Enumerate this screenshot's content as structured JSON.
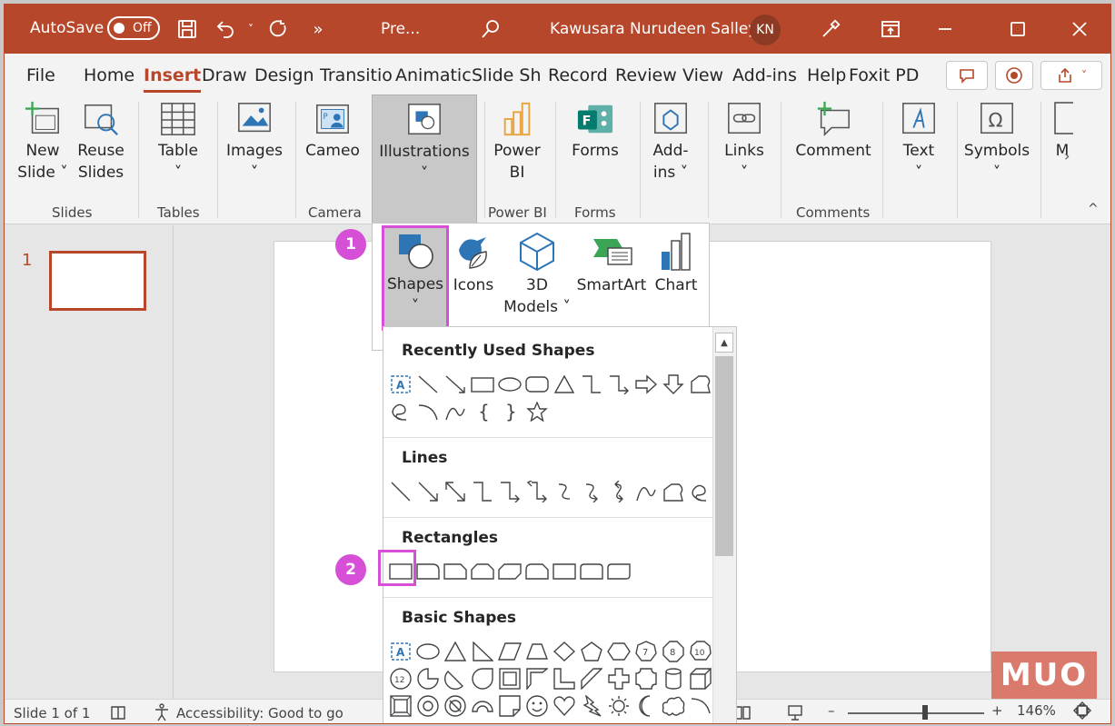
{
  "titlebar": {
    "autosave_label": "AutoSave",
    "autosave_state": "Off",
    "doc_title": "Pre...",
    "user_name": "Kawusara Nurudeen Salley",
    "user_initials": "KN",
    "bg_color": "#b7472a"
  },
  "tabs": [
    "File",
    "Home",
    "Insert",
    "Draw",
    "Design",
    "Transitio",
    "Animatic",
    "Slide Sh",
    "Record",
    "Review",
    "View",
    "Add-ins",
    "Help",
    "Foxit PD"
  ],
  "active_tab": "Insert",
  "ribbon": {
    "new_slide": [
      "New",
      "Slide ˅"
    ],
    "reuse_slides": [
      "Reuse",
      "Slides"
    ],
    "table": "Table",
    "images": "Images",
    "cameo": "Cameo",
    "illustrations": "Illustrations",
    "power_bi": [
      "Power",
      "BI"
    ],
    "forms": "Forms",
    "add_ins": [
      "Add-",
      "ins ˅"
    ],
    "links": "Links",
    "comment": "Comment",
    "text": "Text",
    "symbols": "Symbols",
    "media_partial": "M",
    "groups": [
      "Slides",
      "Tables",
      "Camera",
      "Power BI",
      "Forms",
      "Comments"
    ]
  },
  "slide_panel": {
    "slide_number": "1"
  },
  "illustrations_menu": {
    "shapes": "Shapes",
    "icons": "Icons",
    "models": [
      "3D",
      "Models ˅"
    ],
    "smartart": "SmartArt",
    "chart": "Chart"
  },
  "shapes_gallery": {
    "recent": "Recently Used Shapes",
    "lines": "Lines",
    "rectangles": "Rectangles",
    "basic": "Basic Shapes"
  },
  "callouts": {
    "one": "1",
    "two": "2",
    "color": "#d64fd7"
  },
  "status": {
    "slide": "Slide 1 of 1",
    "accessibility": "Accessibility: Good to go",
    "zoom": "146%"
  },
  "watermark": "MUO"
}
